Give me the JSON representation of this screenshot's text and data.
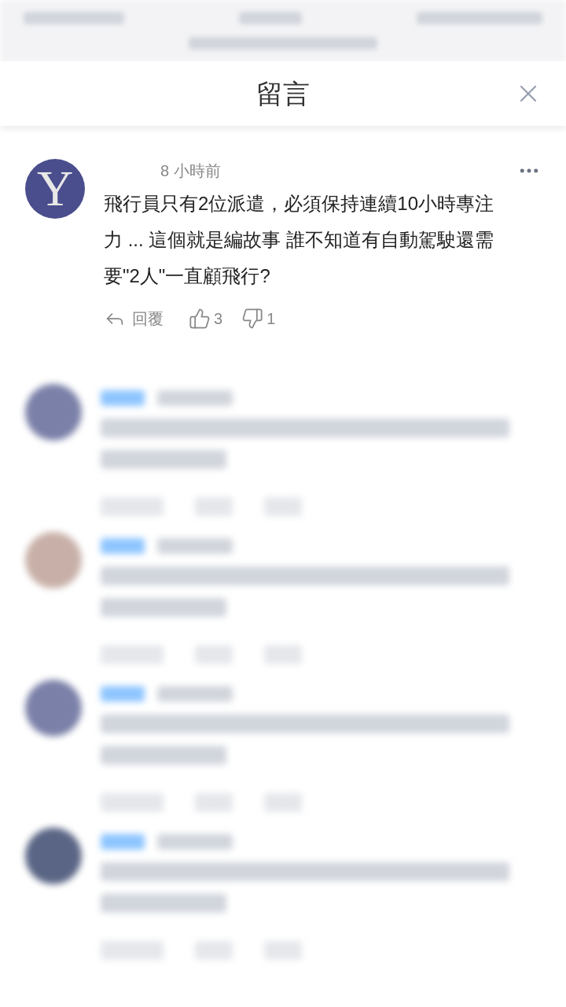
{
  "browser_bar": {
    "kind": "blurred"
  },
  "header": {
    "title": "留言"
  },
  "comment": {
    "avatar": "Y",
    "time": "8 小時前",
    "text": "飛行員只有2位派遣，必須保持連續10小時專注力 ... 這個就是編故事 誰不知道有自動駕駛還需要\"2人\"一直顧飛行?",
    "reply": "回覆",
    "likes": "3",
    "dislikes": "1"
  },
  "blurred_comments": [
    {
      "kind": "blurred",
      "color": "#7a80a8"
    },
    {
      "kind": "blurred",
      "color": "#c8b0a8"
    },
    {
      "kind": "blurred",
      "color": "#7a80a8"
    },
    {
      "kind": "blurred",
      "color": "#5a6585"
    }
  ]
}
